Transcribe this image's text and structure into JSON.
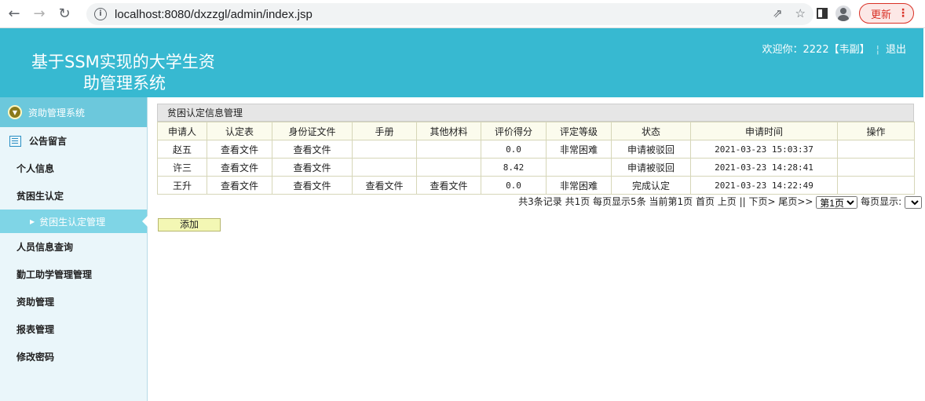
{
  "browser": {
    "url": "localhost:8080/dxzzgl/admin/index.jsp",
    "update_label": "更新"
  },
  "header": {
    "title_line1": "基于SSM实现的大学生资",
    "title_line2": "助管理系统",
    "welcome": "欢迎你：2222【韦副】",
    "logout": "退出",
    "color": "#37b9d1"
  },
  "sidebar": {
    "head": "资助管理系统",
    "items": [
      {
        "label": "公告留言"
      },
      {
        "label": "个人信息"
      },
      {
        "label": "贫困生认定"
      }
    ],
    "active_sub": "贫困生认定管理",
    "items2": [
      {
        "label": "人员信息查询"
      },
      {
        "label": "勤工助学管理管理"
      },
      {
        "label": "资助管理"
      },
      {
        "label": "报表管理"
      },
      {
        "label": "修改密码"
      }
    ]
  },
  "main": {
    "panel_title": "贫困认定信息管理",
    "columns": [
      "申请人",
      "认定表",
      "身份证文件",
      "手册",
      "其他材料",
      "评价得分",
      "评定等级",
      "状态",
      "申请时间",
      "操作"
    ],
    "rows": [
      [
        "赵五",
        "查看文件",
        "查看文件",
        "",
        "",
        "0.0",
        "非常困难",
        "申请被驳回",
        "2021-03-23 15:03:37",
        ""
      ],
      [
        "许三",
        "查看文件",
        "查看文件",
        "",
        "",
        "8.42",
        "",
        "申请被驳回",
        "2021-03-23 14:28:41",
        ""
      ],
      [
        "王升",
        "查看文件",
        "查看文件",
        "查看文件",
        "查看文件",
        "0.0",
        "非常困难",
        "完成认定",
        "2021-03-23 14:22:49",
        ""
      ]
    ],
    "pager_text": "共3条记录  共1页  每页显示5条  当前第1页  首页  上页  ||  下页>  尾页>>",
    "page_select": "第1页",
    "per_page_label": "每页显示:",
    "add_label": "添加"
  }
}
